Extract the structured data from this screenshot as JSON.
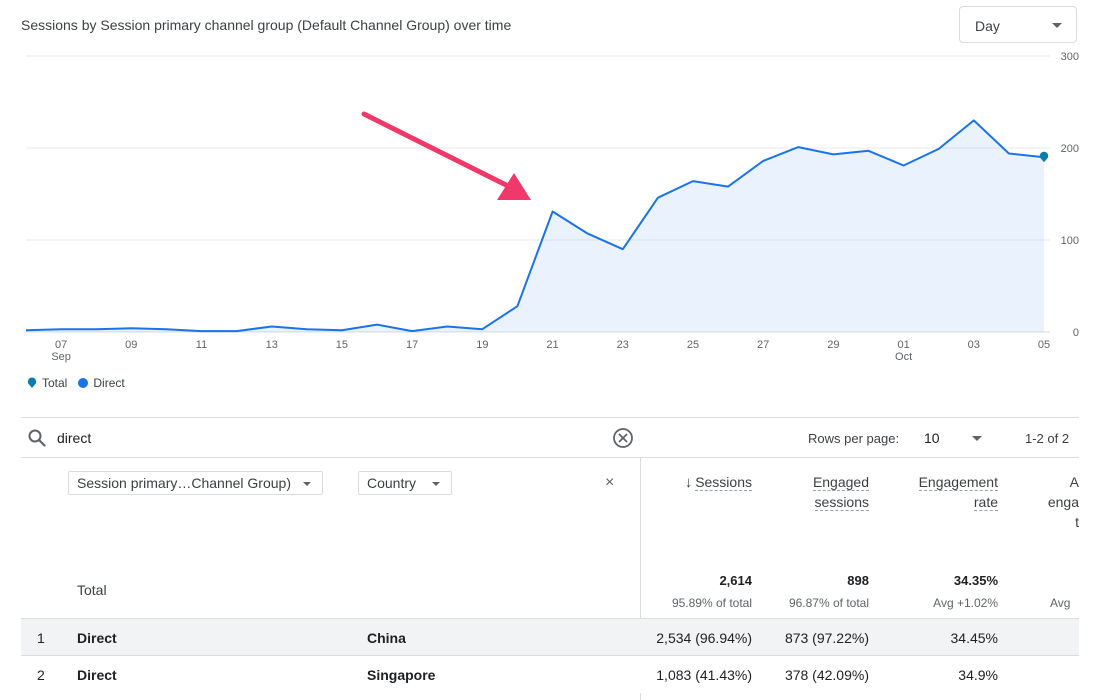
{
  "chart": {
    "title": "Sessions by Session primary channel group (Default Channel Group) over time",
    "granularity": "Day",
    "accent_color": "#1a73e8",
    "arrow_color": "#f0386b",
    "legend": [
      {
        "label": "Total",
        "icon": "pin-icon"
      },
      {
        "label": "Direct",
        "icon": "dot-icon"
      }
    ]
  },
  "chart_data": {
    "type": "area",
    "x": [
      "06 Sep",
      "07 Sep",
      "08 Sep",
      "09 Sep",
      "10 Sep",
      "11 Sep",
      "12 Sep",
      "13 Sep",
      "14 Sep",
      "15 Sep",
      "16 Sep",
      "17 Sep",
      "18 Sep",
      "19 Sep",
      "20 Sep",
      "21 Sep",
      "22 Sep",
      "23 Sep",
      "24 Sep",
      "25 Sep",
      "26 Sep",
      "27 Sep",
      "28 Sep",
      "29 Sep",
      "30 Sep",
      "01 Oct",
      "02 Oct",
      "03 Oct",
      "04 Oct",
      "05 Oct"
    ],
    "series": [
      {
        "name": "Direct",
        "values": [
          2,
          3,
          3,
          4,
          3,
          1,
          1,
          6,
          3,
          2,
          8,
          1,
          6,
          3,
          28,
          131,
          107,
          90,
          146,
          164,
          158,
          186,
          201,
          193,
          197,
          181,
          199,
          230,
          194,
          190
        ]
      }
    ],
    "x_tick_labels": [
      {
        "index": 1,
        "label": "07",
        "sub": "Sep"
      },
      {
        "index": 3,
        "label": "09",
        "sub": ""
      },
      {
        "index": 5,
        "label": "11",
        "sub": ""
      },
      {
        "index": 7,
        "label": "13",
        "sub": ""
      },
      {
        "index": 9,
        "label": "15",
        "sub": ""
      },
      {
        "index": 11,
        "label": "17",
        "sub": ""
      },
      {
        "index": 13,
        "label": "19",
        "sub": ""
      },
      {
        "index": 15,
        "label": "21",
        "sub": ""
      },
      {
        "index": 17,
        "label": "23",
        "sub": ""
      },
      {
        "index": 19,
        "label": "25",
        "sub": ""
      },
      {
        "index": 21,
        "label": "27",
        "sub": ""
      },
      {
        "index": 23,
        "label": "29",
        "sub": ""
      },
      {
        "index": 25,
        "label": "01",
        "sub": "Oct"
      },
      {
        "index": 27,
        "label": "03",
        "sub": ""
      },
      {
        "index": 29,
        "label": "05",
        "sub": ""
      }
    ],
    "y_ticks": [
      0,
      100,
      200,
      300
    ],
    "ylim": [
      0,
      300
    ],
    "grid": true,
    "legend_position": "bottom-left"
  },
  "table": {
    "search_value": "direct",
    "rows_per_page_label": "Rows per page:",
    "rows_per_page_value": "10",
    "range_label": "1-2 of 2",
    "dimension_chips": [
      "Session primary…Channel Group)",
      "Country"
    ],
    "close_symbol": "×",
    "columns": {
      "sessions": "Sessions",
      "engaged_line1": "Engaged",
      "engaged_line2": "sessions",
      "rate_line1": "Engagement",
      "rate_line2": "rate",
      "avg_line1": "A",
      "avg_line2": "enga",
      "avg_line3": "t"
    },
    "total": {
      "label": "Total",
      "sessions": "2,614",
      "sessions_sub": "95.89% of total",
      "engaged": "898",
      "engaged_sub": "96.87% of total",
      "rate": "34.35%",
      "rate_sub": "Avg +1.02%",
      "avg_sub": "Avg"
    },
    "rows": [
      {
        "index": "1",
        "channel": "Direct",
        "country": "China",
        "sessions": "2,534 (96.94%)",
        "engaged": "873 (97.22%)",
        "rate": "34.45%"
      },
      {
        "index": "2",
        "channel": "Direct",
        "country": "Singapore",
        "sessions": "1,083 (41.43%)",
        "engaged": "378 (42.09%)",
        "rate": "34.9%"
      }
    ]
  }
}
